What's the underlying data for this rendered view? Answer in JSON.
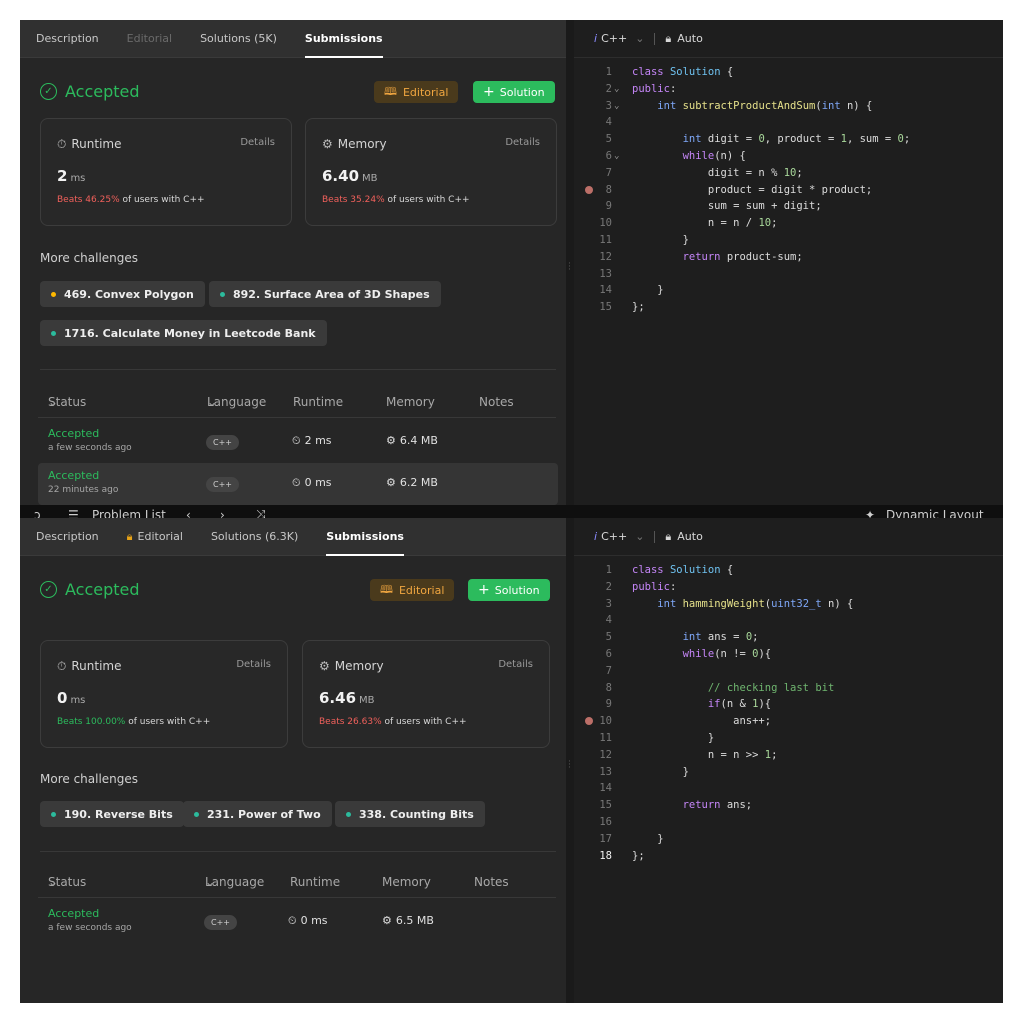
{
  "top_strip": {
    "left_label": "Problem List",
    "right_label": "Dynamic Layout"
  },
  "shots": [
    {
      "tabs": {
        "description": "Description",
        "editorial": "Editorial",
        "solutions": "Solutions (5K)",
        "submissions": "Submissions"
      },
      "status": "Accepted",
      "buttons": {
        "editorial": "Editorial",
        "solution": "Solution"
      },
      "runtime": {
        "title": "Runtime",
        "details": "Details",
        "value": "2",
        "unit": "ms",
        "beats_pct": "Beats 46.25%",
        "beats_suffix": " of users with C++"
      },
      "memory": {
        "title": "Memory",
        "details": "Details",
        "value": "6.40",
        "unit": "MB",
        "beats_pct": "Beats 35.24%",
        "beats_suffix": " of users with C++"
      },
      "more_challenges": {
        "title": "More challenges",
        "items": [
          "469. Convex Polygon",
          "892. Surface Area of 3D Shapes",
          "1716. Calculate Money in Leetcode Bank"
        ],
        "dot_colors": [
          "#ffb800",
          "#2cbb9d",
          "#2cbb9d"
        ]
      },
      "table": {
        "headers": {
          "status": "Status",
          "language": "Language",
          "runtime": "Runtime",
          "memory": "Memory",
          "notes": "Notes"
        },
        "rows": [
          {
            "status": "Accepted",
            "time": "a few seconds ago",
            "language": "C++",
            "runtime": "2 ms",
            "memory": "6.4 MB"
          },
          {
            "status": "Accepted",
            "time": "22 minutes ago",
            "language": "C++",
            "runtime": "0 ms",
            "memory": "6.2 MB"
          }
        ]
      },
      "editor": {
        "language": "C++",
        "mode": "Auto"
      },
      "code": [
        "class Solution {",
        "public:",
        "    int subtractProductAndSum(int n) {",
        "",
        "        int digit = 0, product = 1, sum = 0;",
        "        while(n) {",
        "            digit = n % 10;",
        "            product = digit * product;",
        "            sum = sum + digit;",
        "            n = n / 10;",
        "        }",
        "        return product-sum;",
        "",
        "    }",
        "};"
      ]
    },
    {
      "tabs": {
        "description": "Description",
        "editorial": "Editorial",
        "solutions": "Solutions (6.3K)",
        "submissions": "Submissions"
      },
      "status": "Accepted",
      "buttons": {
        "editorial": "Editorial",
        "solution": "Solution"
      },
      "runtime": {
        "title": "Runtime",
        "details": "Details",
        "value": "0",
        "unit": "ms",
        "beats_pct": "Beats 100.00%",
        "beats_suffix": " of users with C++"
      },
      "memory": {
        "title": "Memory",
        "details": "Details",
        "value": "6.46",
        "unit": "MB",
        "beats_pct": "Beats 26.63%",
        "beats_suffix": " of users with C++"
      },
      "more_challenges": {
        "title": "More challenges",
        "items": [
          "190. Reverse Bits",
          "231. Power of Two",
          "338. Counting Bits"
        ],
        "dot_colors": [
          "#2cbb9d",
          "#2cbb9d",
          "#2cbb9d"
        ]
      },
      "table": {
        "headers": {
          "status": "Status",
          "language": "Language",
          "runtime": "Runtime",
          "memory": "Memory",
          "notes": "Notes"
        },
        "rows": [
          {
            "status": "Accepted",
            "time": "a few seconds ago",
            "language": "C++",
            "runtime": "0 ms",
            "memory": "6.5 MB"
          }
        ]
      },
      "editor": {
        "language": "C++",
        "mode": "Auto"
      },
      "code": [
        "class Solution {",
        "public:",
        "    int hammingWeight(uint32_t n) {",
        "",
        "        int ans = 0;",
        "        while(n != 0){",
        "",
        "            // checking last bit",
        "            if(n & 1){",
        "                ans++;",
        "            }",
        "            n = n >> 1;",
        "        }",
        "",
        "        return ans;",
        "",
        "    }",
        "};"
      ]
    }
  ]
}
